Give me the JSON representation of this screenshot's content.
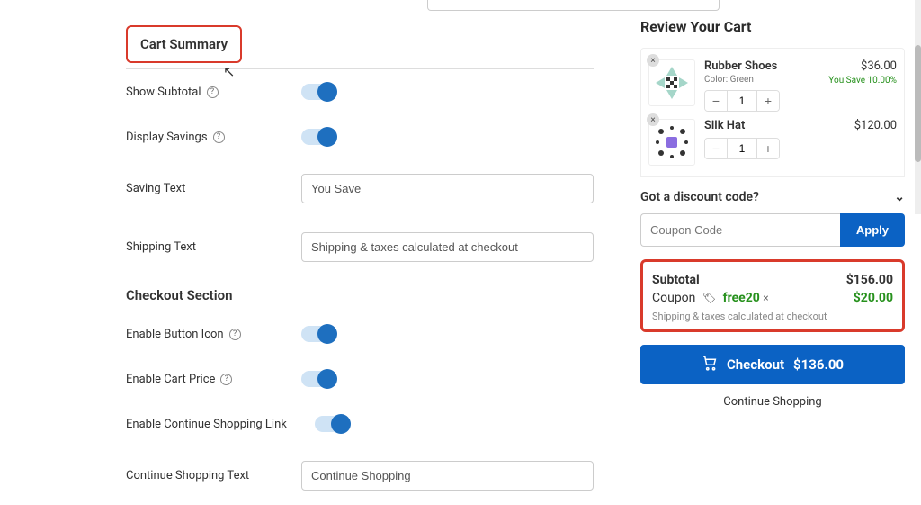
{
  "settings": {
    "apply_row_placeholder": "Apply",
    "cart_summary_heading": "Cart Summary",
    "rows": {
      "show_subtotal": "Show Subtotal",
      "display_savings": "Display Savings",
      "saving_text_label": "Saving Text",
      "saving_text_value": "You Save",
      "shipping_text_label": "Shipping Text",
      "shipping_text_value": "Shipping & taxes calculated at checkout"
    },
    "checkout_heading": "Checkout Section",
    "checkout_rows": {
      "enable_button_icon": "Enable Button Icon",
      "enable_cart_price": "Enable Cart Price",
      "enable_continue_link": "Enable Continue Shopping Link",
      "continue_text_label": "Continue Shopping Text",
      "continue_text_value": "Continue Shopping"
    }
  },
  "cart": {
    "heading": "Review Your Cart",
    "items": [
      {
        "name": "Rubber Shoes",
        "variant": "Color: Green",
        "qty": "1",
        "price": "$36.00",
        "savings": "You Save 10.00%"
      },
      {
        "name": "Silk Hat",
        "variant": "",
        "qty": "1",
        "price": "$120.00",
        "savings": ""
      }
    ],
    "discount_heading": "Got a discount code?",
    "coupon_placeholder": "Coupon Code",
    "apply_label": "Apply",
    "subtotal_label": "Subtotal",
    "subtotal_value": "$156.00",
    "coupon_label": "Coupon",
    "coupon_code": "free20",
    "coupon_amount": "$20.00",
    "shipping_note": "Shipping & taxes calculated at checkout",
    "checkout_prefix": "Checkout",
    "checkout_total": "$136.00",
    "continue_shopping": "Continue Shopping"
  }
}
